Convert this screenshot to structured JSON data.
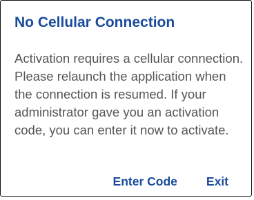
{
  "dialog": {
    "title": "No Cellular Connection",
    "message": "Activation requires a cellular connection. Please relaunch the application when the connection is resumed. If your administrator gave you an activation code, you can enter it now to activate.",
    "buttons": {
      "enter_code": "Enter Code",
      "exit": "Exit"
    }
  },
  "colors": {
    "accent": "#1a4b9c",
    "body_text": "#555555",
    "border": "#111111"
  }
}
